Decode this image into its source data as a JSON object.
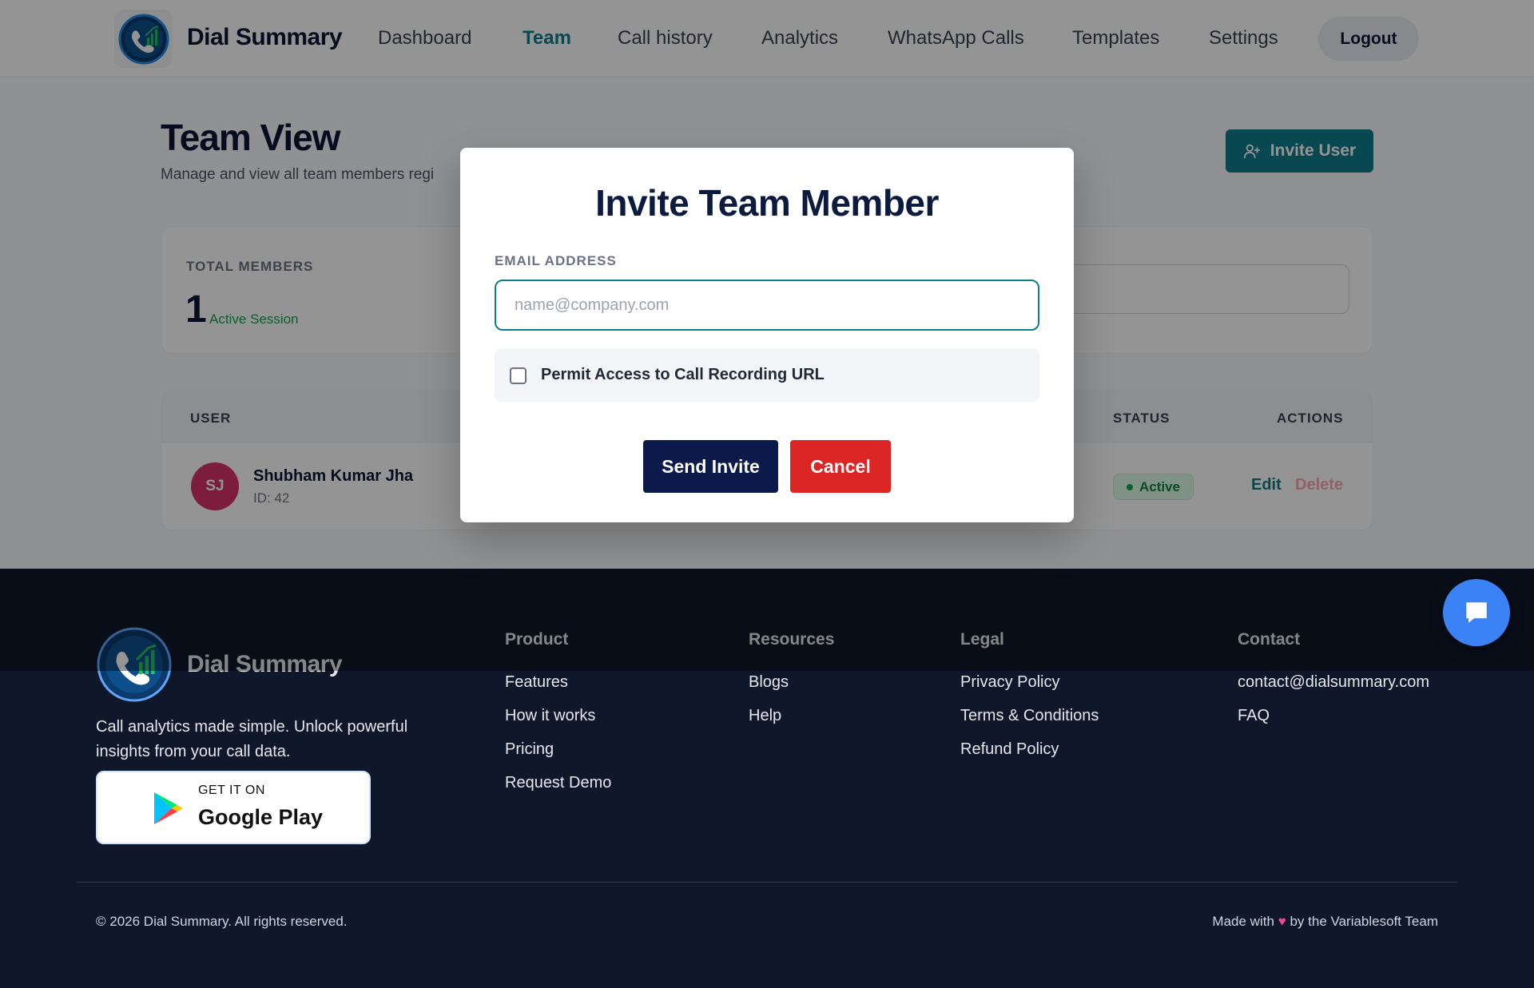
{
  "header": {
    "brand": "Dial Summary",
    "nav": [
      {
        "label": "Dashboard",
        "active": false
      },
      {
        "label": "Team",
        "active": true
      },
      {
        "label": "Call history",
        "active": false
      },
      {
        "label": "Analytics",
        "active": false
      },
      {
        "label": "WhatsApp Calls",
        "active": false
      },
      {
        "label": "Templates",
        "active": false
      },
      {
        "label": "Settings",
        "active": false
      }
    ],
    "logout_label": "Logout"
  },
  "page": {
    "title": "Team View",
    "subtitle": "Manage and view all team members regi",
    "invite_button": "Invite User"
  },
  "stats": {
    "total_label": "TOTAL MEMBERS",
    "total_value": "1",
    "session_note": "Active Session"
  },
  "table": {
    "columns": {
      "user": "USER",
      "status": "STATUS",
      "actions": "ACTIONS"
    },
    "rows": [
      {
        "initials": "SJ",
        "name": "Shubham Kumar Jha",
        "id": "ID: 42",
        "status": "Active",
        "edit": "Edit",
        "delete": "Delete"
      }
    ]
  },
  "modal": {
    "title": "Invite Team Member",
    "email_label": "EMAIL ADDRESS",
    "email_placeholder": "name@company.com",
    "email_value": "",
    "permission_label": "Permit Access to Call Recording URL",
    "permission_checked": false,
    "send_label": "Send Invite",
    "cancel_label": "Cancel"
  },
  "footer": {
    "brand": "Dial Summary",
    "tagline": "Call analytics made simple. Unlock powerful insights from your call data.",
    "gplay_small": "GET IT ON",
    "gplay_big": "Google Play",
    "columns": [
      {
        "title": "Product",
        "links": [
          "Features",
          "How it works",
          "Pricing",
          "Request Demo"
        ]
      },
      {
        "title": "Resources",
        "links": [
          "Blogs",
          "Help"
        ]
      },
      {
        "title": "Legal",
        "links": [
          "Privacy Policy",
          "Terms & Conditions",
          "Refund Policy"
        ]
      },
      {
        "title": "Contact",
        "links": [
          "contact@dialsummary.com",
          "FAQ"
        ]
      }
    ],
    "copyright": "© 2026 Dial Summary. All rights reserved.",
    "made_with_prefix": "Made with",
    "made_with_suffix": "by the Variablesoft Team"
  },
  "colors": {
    "accent": "#0f7c8c",
    "navy": "#0b1a4a",
    "danger": "#dc2626",
    "success": "#16a34a",
    "footer_bg": "#0f172a",
    "chat_fab": "#3b82f6"
  },
  "icons": {
    "logo": "phone-chart-logo-icon",
    "invite": "user-plus-icon",
    "chat": "chat-bubble-icon",
    "play": "google-play-icon"
  }
}
